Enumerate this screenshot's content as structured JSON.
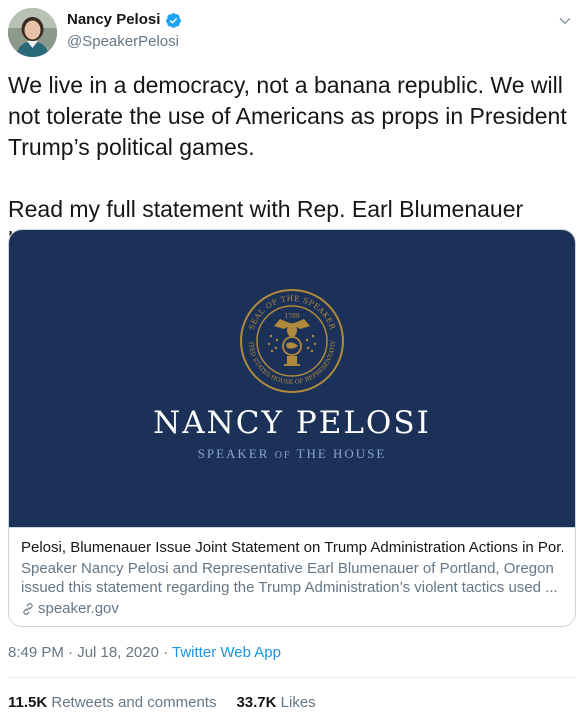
{
  "author": {
    "display_name": "Nancy Pelosi",
    "handle": "@SpeakerPelosi",
    "verified": true,
    "avatar_icon": "profile-photo"
  },
  "tweet": {
    "text": "We live in a democracy, not a banana republic. We will not tolerate the use of Americans as props in President Trump’s political games.\n\nRead my full statement with Rep. Earl Blumenauer here:"
  },
  "card": {
    "image": {
      "seal_text_top": "SEAL OF THE SPEAKER",
      "seal_text_bottom": "UNITED STATES HOUSE OF REPRESENTATIVES",
      "seal_year": "1789",
      "name": "NANCY PELOSI",
      "subtitle_part1": "SPEAKER ",
      "subtitle_of": "OF",
      "subtitle_part2": " THE HOUSE",
      "background_color": "#1b3158",
      "seal_color": "#b08a3c"
    },
    "headline": "Pelosi, Blumenauer Issue Joint Statement on Trump Administration Actions in Por...",
    "description": "Speaker Nancy Pelosi and Representative Earl Blumenauer of Portland, Oregon issued this statement regarding the Trump Administration’s violent tactics used ...",
    "domain": "speaker.gov"
  },
  "meta": {
    "time": "8:49 PM",
    "separator": " · ",
    "date": "Jul 18, 2020",
    "app": "Twitter Web App"
  },
  "stats": {
    "retweets_count": "11.5K",
    "retweets_label": "Retweets and comments",
    "likes_count": "33.7K",
    "likes_label": "Likes"
  },
  "colors": {
    "link": "#1b95e0",
    "secondary_text": "#657786",
    "verified": "#1da1f2"
  }
}
